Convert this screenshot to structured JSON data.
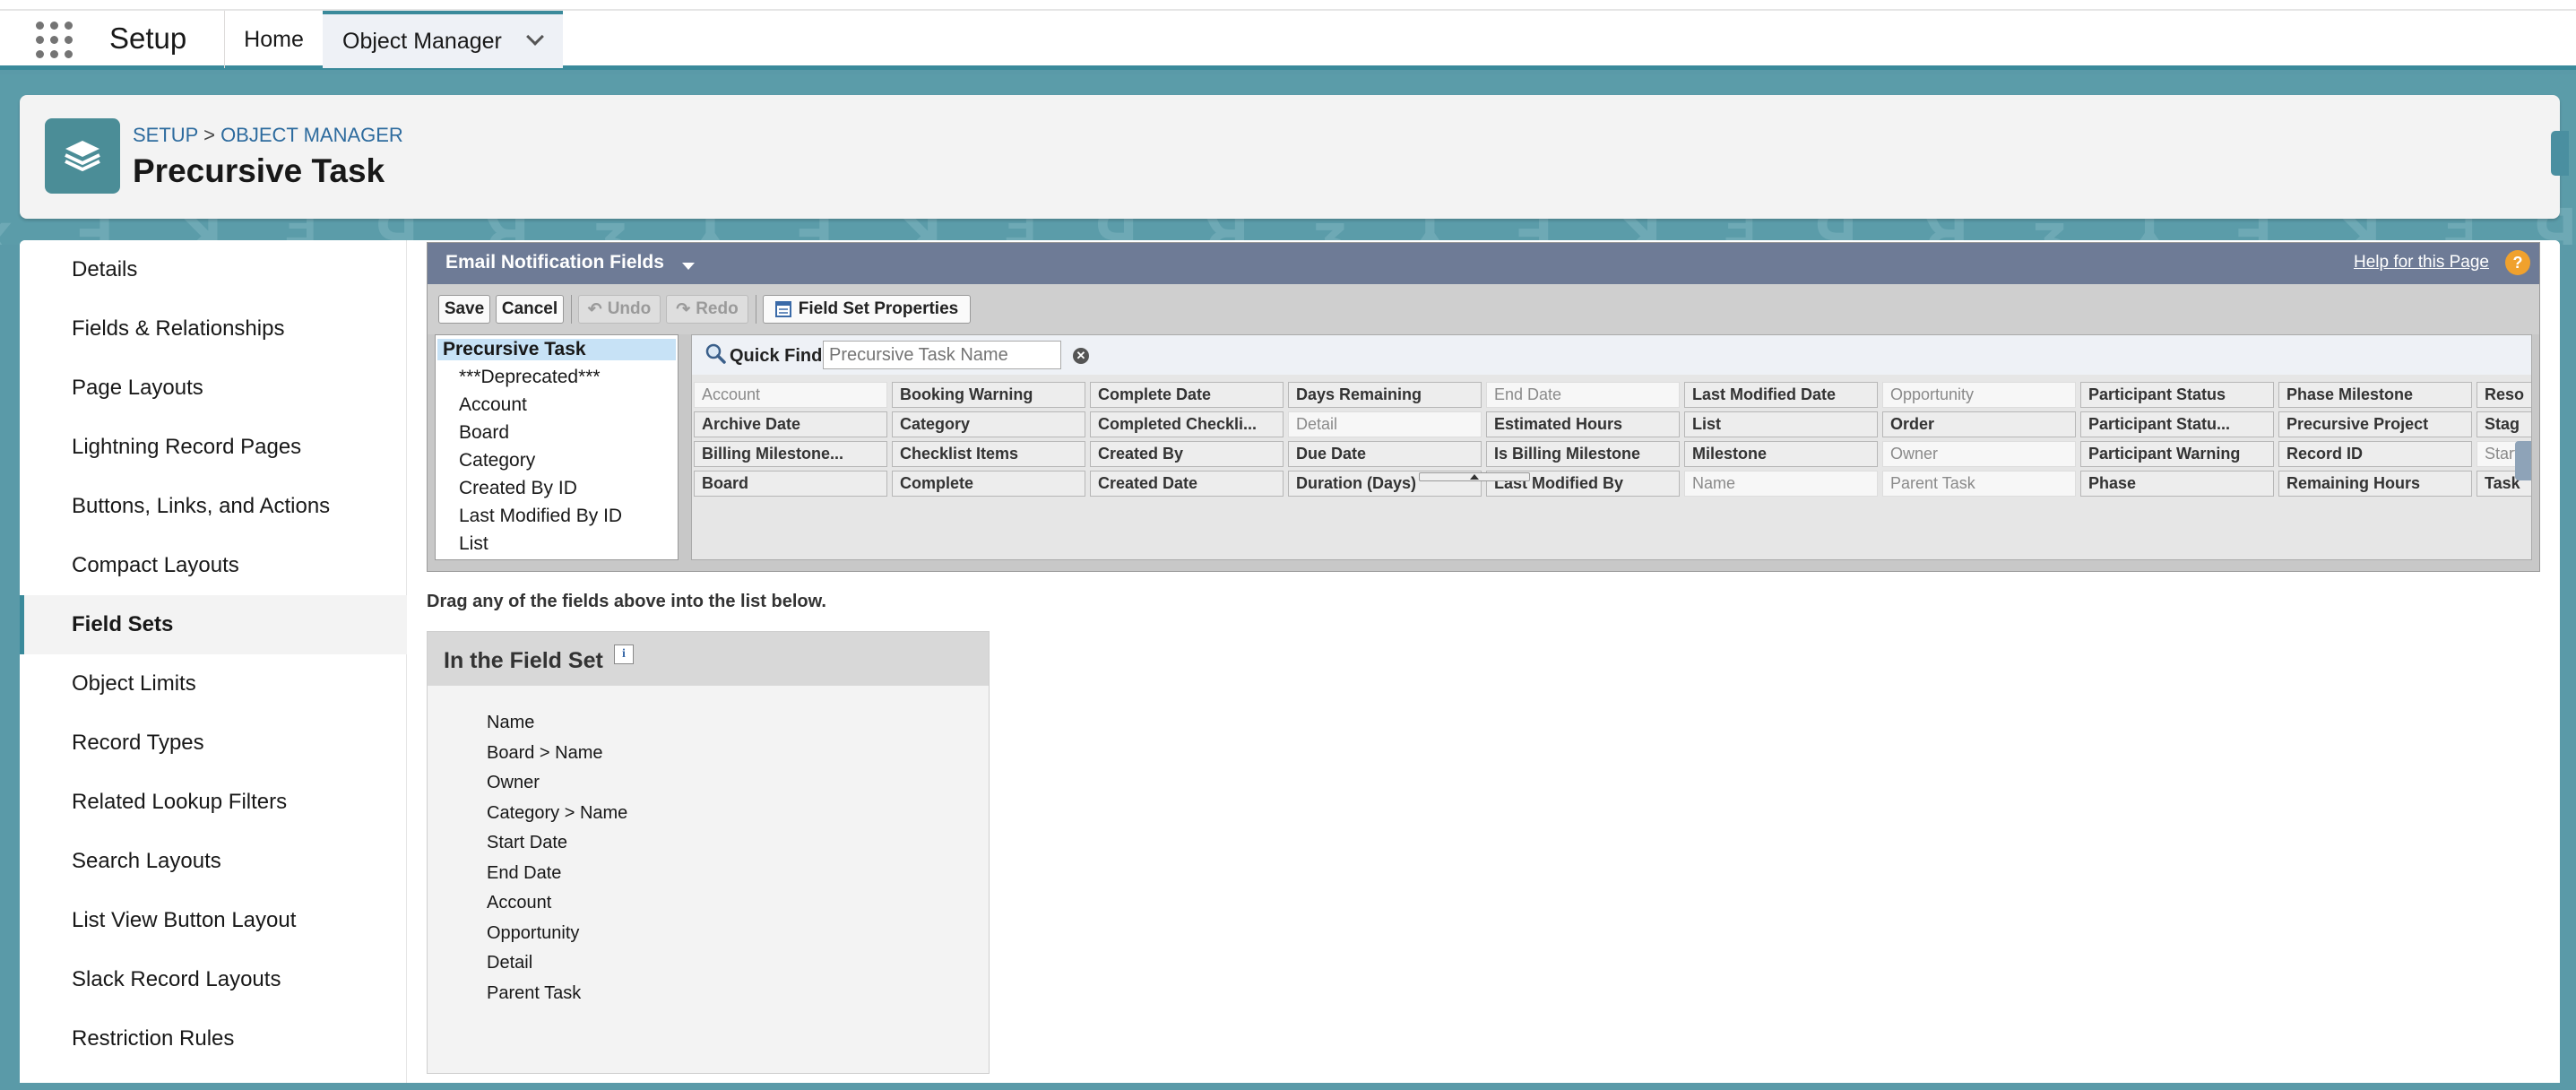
{
  "app": {
    "name": "Setup"
  },
  "nav": {
    "home": "Home",
    "object_manager": "Object Manager"
  },
  "header": {
    "breadcrumb_setup": "SETUP",
    "breadcrumb_sep": ">",
    "breadcrumb_om": "OBJECT MANAGER",
    "title": "Precursive Task"
  },
  "sidebar": {
    "items": [
      "Details",
      "Fields & Relationships",
      "Page Layouts",
      "Lightning Record Pages",
      "Buttons, Links, and Actions",
      "Compact Layouts",
      "Field Sets",
      "Object Limits",
      "Record Types",
      "Related Lookup Filters",
      "Search Layouts",
      "List View Button Layout",
      "Slack Record Layouts",
      "Restriction Rules"
    ],
    "active": "Field Sets"
  },
  "palette": {
    "title": "Email Notification Fields",
    "help": "Help for this Page",
    "help_icon": "?",
    "toolbar": {
      "save": "Save",
      "cancel": "Cancel",
      "undo": "Undo",
      "redo": "Redo",
      "properties": "Field Set Properties"
    },
    "objects": [
      "Precursive Task",
      "***Deprecated***",
      "Account",
      "Board",
      "Category",
      "Created By ID",
      "Last Modified By ID",
      "List"
    ],
    "quick_find": {
      "label": "Quick Find",
      "placeholder": "Precursive Task Name"
    },
    "field_rows": [
      [
        "Account",
        "Booking Warning",
        "Complete Date",
        "Days Remaining",
        "End Date",
        "Last Modified Date",
        "Opportunity",
        "Participant Status",
        "Phase Milestone",
        "Reso"
      ],
      [
        "Archive Date",
        "Category",
        "Completed Checkli...",
        "Detail",
        "Estimated Hours",
        "List",
        "Order",
        "Participant Statu...",
        "Precursive Project",
        "Stag"
      ],
      [
        "Billing Milestone...",
        "Checklist Items",
        "Created By",
        "Due Date",
        "Is Billing Milestone",
        "Milestone",
        "Owner",
        "Participant Warning",
        "Record ID",
        "Start"
      ],
      [
        "Board",
        "Complete",
        "Created Date",
        "Duration (Days)",
        "Last Modified By",
        "Name",
        "Parent Task",
        "Phase",
        "Remaining Hours",
        "Task"
      ]
    ],
    "used_fields": [
      "Account",
      "End Date",
      "Opportunity",
      "Detail",
      "Owner",
      "Start",
      "Name",
      "Parent Task"
    ]
  },
  "drag_hint": "Drag any of the fields above into the list below.",
  "field_set": {
    "title": "In the Field Set",
    "info_icon": "i",
    "fields": [
      "Name",
      "Board > Name",
      "Owner",
      "Category > Name",
      "Start Date",
      "End Date",
      "Account",
      "Opportunity",
      "Detail",
      "Parent Task"
    ]
  }
}
